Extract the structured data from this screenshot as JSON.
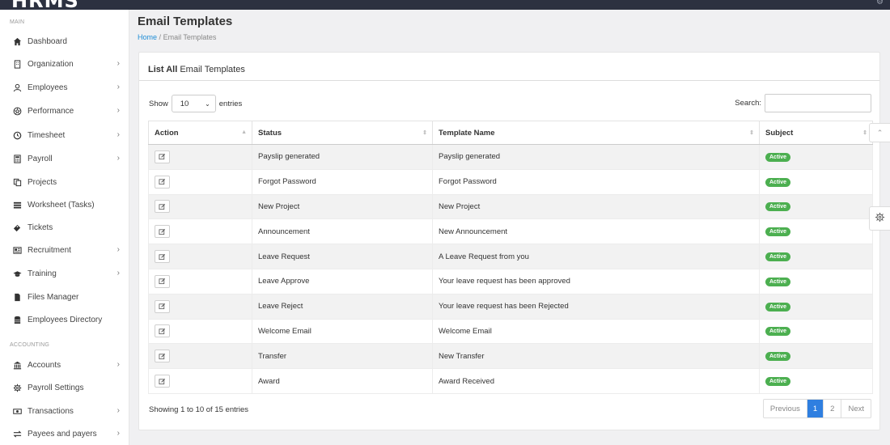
{
  "app": {
    "logo": "HRMS"
  },
  "sidebar": {
    "sections": [
      {
        "label": "MAIN"
      },
      {
        "label": "ACCOUNTING"
      }
    ],
    "items": [
      {
        "label": "Dashboard",
        "icon": "home-icon",
        "has_chevron": false
      },
      {
        "label": "Organization",
        "icon": "building-icon",
        "has_chevron": true
      },
      {
        "label": "Employees",
        "icon": "user-icon",
        "has_chevron": true
      },
      {
        "label": "Performance",
        "icon": "aperture-icon",
        "has_chevron": true
      },
      {
        "label": "Timesheet",
        "icon": "clock-icon",
        "has_chevron": true
      },
      {
        "label": "Payroll",
        "icon": "calculator-icon",
        "has_chevron": true
      },
      {
        "label": "Projects",
        "icon": "copy-icon",
        "has_chevron": false
      },
      {
        "label": "Worksheet (Tasks)",
        "icon": "tasks-icon",
        "has_chevron": false
      },
      {
        "label": "Tickets",
        "icon": "ticket-icon",
        "has_chevron": false
      },
      {
        "label": "Recruitment",
        "icon": "newspaper-icon",
        "has_chevron": true
      },
      {
        "label": "Training",
        "icon": "graduation-cap-icon",
        "has_chevron": true
      },
      {
        "label": "Files Manager",
        "icon": "file-icon",
        "has_chevron": false
      },
      {
        "label": "Employees Directory",
        "icon": "database-icon",
        "has_chevron": false
      },
      {
        "label": "Accounts",
        "icon": "bank-icon",
        "has_chevron": true
      },
      {
        "label": "Payroll Settings",
        "icon": "gear-icon",
        "has_chevron": false
      },
      {
        "label": "Transactions",
        "icon": "money-icon",
        "has_chevron": true
      },
      {
        "label": "Payees and payers",
        "icon": "exchange-icon",
        "has_chevron": true
      }
    ]
  },
  "header": {
    "title": "Email Templates",
    "breadcrumb_home": "Home",
    "breadcrumb_sep": "/",
    "breadcrumb_current": "Email Templates"
  },
  "card": {
    "title_bold": "List All",
    "title_rest": "Email Templates",
    "show_label": "Show",
    "entries_value": "10",
    "entries_label": "entries",
    "search_label": "Search:",
    "search_value": ""
  },
  "table": {
    "columns": [
      "Action",
      "Status",
      "Template Name",
      "Subject"
    ],
    "rows": [
      {
        "status": "Payslip generated",
        "template_name": "Payslip generated",
        "subject": "Active"
      },
      {
        "status": "Forgot Password",
        "template_name": "Forgot Password",
        "subject": "Active"
      },
      {
        "status": "New Project",
        "template_name": "New Project",
        "subject": "Active"
      },
      {
        "status": "Announcement",
        "template_name": "New Announcement",
        "subject": "Active"
      },
      {
        "status": "Leave Request",
        "template_name": "A Leave Request from you",
        "subject": "Active"
      },
      {
        "status": "Leave Approve",
        "template_name": "Your leave request has been approved",
        "subject": "Active"
      },
      {
        "status": "Leave Reject",
        "template_name": "Your leave request has been Rejected",
        "subject": "Active"
      },
      {
        "status": "Welcome Email",
        "template_name": "Welcome Email",
        "subject": "Active"
      },
      {
        "status": "Transfer",
        "template_name": "New Transfer",
        "subject": "Active"
      },
      {
        "status": "Award",
        "template_name": "Award Received",
        "subject": "Active"
      }
    ]
  },
  "footer": {
    "info": "Showing 1 to 10 of 15 entries",
    "pager": [
      "Previous",
      "1",
      "2",
      "Next"
    ],
    "active_page": "1"
  },
  "colors": {
    "accent": "#2f7fe0",
    "badge_active": "#4caf50",
    "topbar": "#2c3140"
  }
}
